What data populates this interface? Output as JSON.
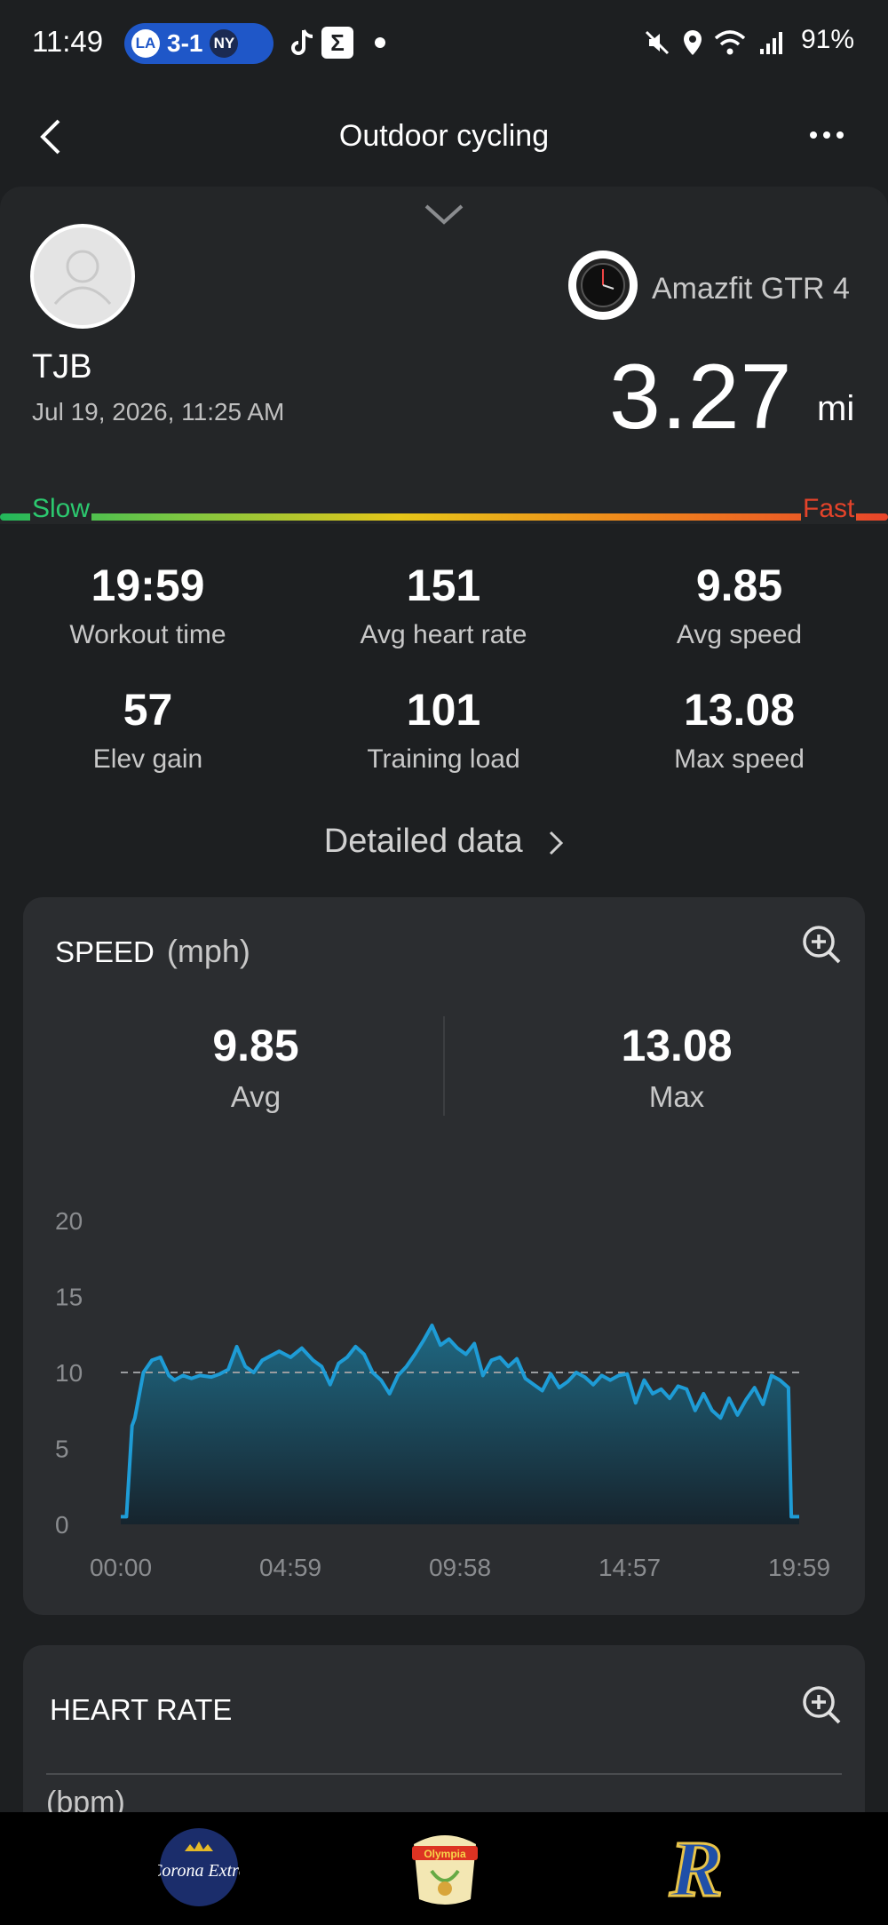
{
  "status_bar": {
    "time": "11:49",
    "score": "3-1",
    "team_home": "LA",
    "team_away": "NY",
    "battery": "91%"
  },
  "app_bar": {
    "title": "Outdoor cycling"
  },
  "summary": {
    "user_name": "TJB",
    "date": "Jul 19, 2026, 11:25 AM",
    "device": "Amazfit GTR 4",
    "distance": "3.27",
    "distance_unit": "mi",
    "pace_slow": "Slow",
    "pace_fast": "Fast"
  },
  "stats": [
    {
      "value": "19:59",
      "label": "Workout time"
    },
    {
      "value": "151",
      "label": "Avg heart rate"
    },
    {
      "value": "9.85",
      "label": "Avg speed"
    },
    {
      "value": "57",
      "label": "Elev gain"
    },
    {
      "value": "101",
      "label": "Training load"
    },
    {
      "value": "13.08",
      "label": "Max speed"
    }
  ],
  "detailed_data_label": "Detailed data",
  "speed_card": {
    "title": "SPEED",
    "unit": "(mph)",
    "avg_value": "9.85",
    "avg_label": "Avg",
    "max_value": "13.08",
    "max_label": "Max"
  },
  "chart_data": {
    "type": "area",
    "title": "SPEED",
    "ylabel": "(mph)",
    "ylim": [
      0,
      20
    ],
    "yticks": [
      0,
      5,
      10,
      15,
      20
    ],
    "xticks": [
      "00:00",
      "04:59",
      "09:58",
      "14:57",
      "19:59"
    ],
    "average_line": 10,
    "series": [
      {
        "x_seconds": [
          0,
          10,
          20,
          25,
          30,
          40,
          55,
          70,
          85,
          95,
          110,
          125,
          140,
          160,
          175,
          190,
          205,
          220,
          235,
          250,
          265,
          280,
          300,
          320,
          340,
          355,
          370,
          385,
          400,
          415,
          430,
          445,
          460,
          475,
          490,
          505,
          520,
          535,
          550,
          565,
          580,
          595,
          610,
          625,
          640,
          655,
          670,
          685,
          700,
          715,
          730,
          745,
          760,
          775,
          790,
          805,
          820,
          835,
          850,
          865,
          880,
          895,
          910,
          925,
          940,
          955,
          970,
          985,
          1000,
          1015,
          1030,
          1045,
          1060,
          1075,
          1090,
          1105,
          1120,
          1135,
          1150,
          1165,
          1180,
          1185,
          1199
        ],
        "values": [
          0.5,
          0.5,
          6.5,
          7,
          8,
          10,
          10.8,
          11,
          9.8,
          9.5,
          9.8,
          9.6,
          9.8,
          9.7,
          9.9,
          10.2,
          11.7,
          10.4,
          10.0,
          10.8,
          11.1,
          11.4,
          11.0,
          11.6,
          10.8,
          10.4,
          9.2,
          10.6,
          11.0,
          11.7,
          11.2,
          10.0,
          9.5,
          8.6,
          9.8,
          10.4,
          11.2,
          12.1,
          13.1,
          11.8,
          12.2,
          11.6,
          11.2,
          11.9,
          9.8,
          10.8,
          11.0,
          10.4,
          10.9,
          9.6,
          9.2,
          8.8,
          9.9,
          9.0,
          9.4,
          10.0,
          9.7,
          9.2,
          9.8,
          9.5,
          9.8,
          9.9,
          8.0,
          9.5,
          8.6,
          8.9,
          8.3,
          9.1,
          8.9,
          7.5,
          8.6,
          7.5,
          7.0,
          8.3,
          7.2,
          8.2,
          9.0,
          7.9,
          9.8,
          9.5,
          9.0,
          0.5,
          0.5
        ]
      }
    ]
  },
  "heart_rate_card": {
    "title": "HEART RATE",
    "unit": "(bpm)"
  },
  "ads": {
    "left": "Corona Extra",
    "center": "Olympia",
    "right": "R"
  }
}
